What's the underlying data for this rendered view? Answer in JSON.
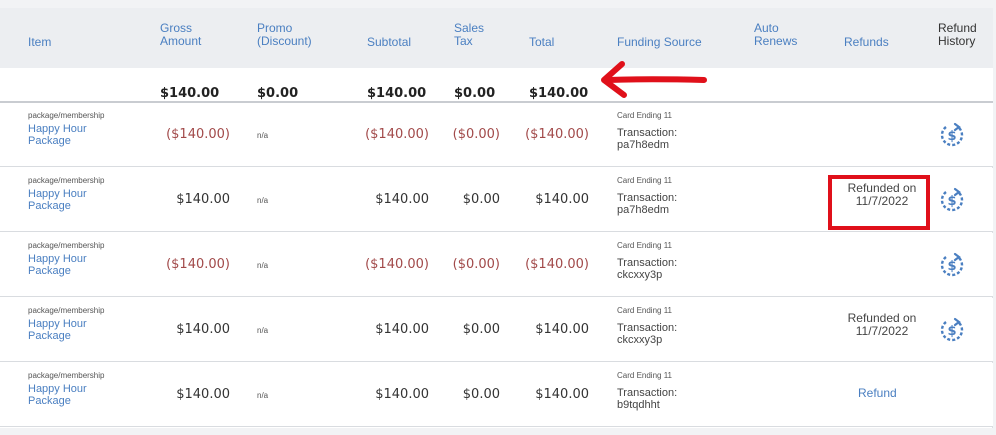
{
  "headers": {
    "item": "Item",
    "gross_1": "Gross",
    "gross_2": "Amount",
    "promo_1": "Promo",
    "promo_2": "(Discount)",
    "subtotal": "Subtotal",
    "tax_1": "Sales",
    "tax_2": "Tax",
    "total": "Total",
    "funding": "Funding Source",
    "auto_1": "Auto",
    "auto_2": "Renews",
    "refunds": "Refunds",
    "hist_1": "Refund",
    "hist_2": "History"
  },
  "totals": {
    "gross": "$140.00",
    "promo": "$0.00",
    "subtotal": "$140.00",
    "tax": "$0.00",
    "total": "$140.00"
  },
  "rows": [
    {
      "category": "package/membership",
      "item_1": "Happy Hour",
      "item_2": "Package",
      "gross": "($140.00)",
      "promo": "n/a",
      "subtotal": "($140.00)",
      "tax": "($0.00)",
      "total": "($140.00)",
      "card": "Card Ending 11",
      "trans_1": "Transaction:",
      "trans_2": "pa7h8edm",
      "refund_1": "",
      "refund_2": ""
    },
    {
      "category": "package/membership",
      "item_1": "Happy Hour",
      "item_2": "Package",
      "gross": "$140.00",
      "promo": "n/a",
      "subtotal": "$140.00",
      "tax": "$0.00",
      "total": "$140.00",
      "card": "Card Ending 11",
      "trans_1": "Transaction:",
      "trans_2": "pa7h8edm",
      "refund_1": "Refunded on",
      "refund_2": "11/7/2022"
    },
    {
      "category": "package/membership",
      "item_1": "Happy Hour",
      "item_2": "Package",
      "gross": "($140.00)",
      "promo": "n/a",
      "subtotal": "($140.00)",
      "tax": "($0.00)",
      "total": "($140.00)",
      "card": "Card Ending 11",
      "trans_1": "Transaction:",
      "trans_2": "ckcxxy3p",
      "refund_1": "",
      "refund_2": ""
    },
    {
      "category": "package/membership",
      "item_1": "Happy Hour",
      "item_2": "Package",
      "gross": "$140.00",
      "promo": "n/a",
      "subtotal": "$140.00",
      "tax": "$0.00",
      "total": "$140.00",
      "card": "Card Ending 11",
      "trans_1": "Transaction:",
      "trans_2": "ckcxxy3p",
      "refund_1": "Refunded on",
      "refund_2": "11/7/2022"
    },
    {
      "category": "package/membership",
      "item_1": "Happy Hour",
      "item_2": "Package",
      "gross": "$140.00",
      "promo": "n/a",
      "subtotal": "$140.00",
      "tax": "$0.00",
      "total": "$140.00",
      "card": "Card Ending 11",
      "trans_1": "Transaction:",
      "trans_2": "b9tqdhht",
      "refund_link": "Refund"
    }
  ],
  "icons": {
    "refund_history": "refund-history-icon",
    "arrow": "red-arrow-annotation"
  },
  "colors": {
    "link": "#4a7fc1",
    "negative": "#a24a4a",
    "annotation": "#e0101a",
    "header_bg": "#eceef1"
  }
}
